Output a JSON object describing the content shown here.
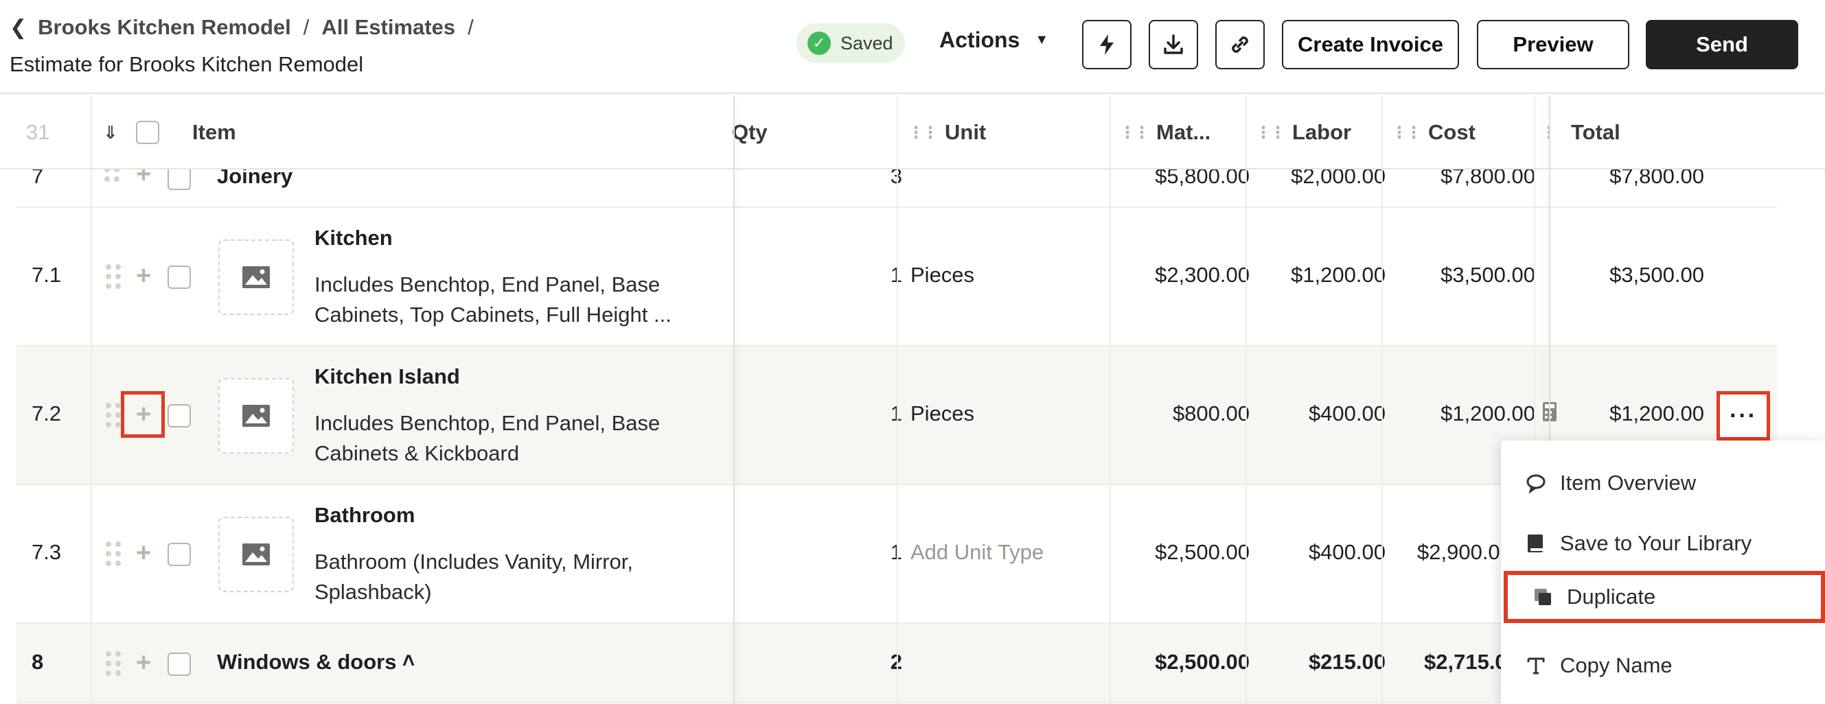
{
  "header": {
    "breadcrumb": [
      "Brooks Kitchen Remodel",
      "All Estimates"
    ],
    "subtitle": "Estimate for Brooks Kitchen Remodel",
    "saved_label": "Saved",
    "actions_label": "Actions",
    "create_invoice_label": "Create Invoice",
    "preview_label": "Preview",
    "send_label": "Send"
  },
  "table": {
    "row_count": "31",
    "columns": {
      "item": "Item",
      "qty": "Qty",
      "unit": "Unit",
      "materials": "Mat...",
      "labor": "Labor",
      "cost": "Cost",
      "total": "Total"
    },
    "rows": [
      {
        "num": "7",
        "name": "Joinery",
        "qty": "3",
        "unit": "",
        "materials": "$5,800.00",
        "labor": "$2,000.00",
        "cost": "$7,800.00",
        "total": "$7,800.00"
      },
      {
        "num": "7.1",
        "name": "Kitchen",
        "desc": "Includes Benchtop, End Panel, Base Cabinets, Top Cabinets, Full Height ...",
        "qty": "1",
        "unit": "Pieces",
        "materials": "$2,300.00",
        "labor": "$1,200.00",
        "cost": "$3,500.00",
        "total": "$3,500.00"
      },
      {
        "num": "7.2",
        "name": "Kitchen Island",
        "desc": "Includes Benchtop, End Panel, Base Cabinets & Kickboard",
        "qty": "1",
        "unit": "Pieces",
        "materials": "$800.00",
        "labor": "$400.00",
        "cost": "$1,200.00",
        "total": "$1,200.00"
      },
      {
        "num": "7.3",
        "name": "Bathroom",
        "desc": "Bathroom (Includes Vanity, Mirror, Splashback)",
        "qty": "1",
        "unit": "Add Unit Type",
        "materials": "$2,500.00",
        "labor": "$400.00",
        "cost": "$2,900.0"
      },
      {
        "num": "8",
        "name": "Windows & doors",
        "qty": "2",
        "unit": "",
        "materials": "$2,500.00",
        "labor": "$215.00",
        "cost": "$2,715.0"
      }
    ]
  },
  "menu": {
    "items": [
      "Item Overview",
      "Save to Your Library",
      "Duplicate",
      "Copy Name"
    ],
    "active": "Duplicate"
  },
  "colors": {
    "highlight_red": "#e03c22",
    "saved_green": "#43b95d",
    "send_dark": "#222222"
  }
}
